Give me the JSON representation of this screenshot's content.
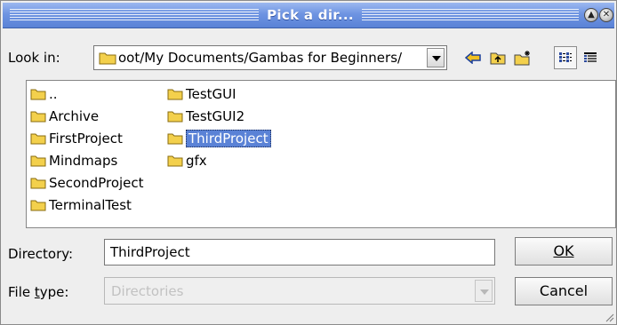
{
  "window": {
    "title": "Pick a dir..."
  },
  "lookin": {
    "label": "Look in:",
    "path": "oot/My Documents/Gambas for Beginners/"
  },
  "toolbar": [
    "back-arrow-icon",
    "parent-folder-icon",
    "new-folder-icon",
    "list-view-icon",
    "detail-view-icon"
  ],
  "files": [
    {
      "name": "..",
      "selected": false
    },
    {
      "name": "Archive",
      "selected": false
    },
    {
      "name": "FirstProject",
      "selected": false
    },
    {
      "name": "Mindmaps",
      "selected": false
    },
    {
      "name": "SecondProject",
      "selected": false
    },
    {
      "name": "TerminalTest",
      "selected": false
    },
    {
      "name": "TestGUI",
      "selected": false
    },
    {
      "name": "TestGUI2",
      "selected": false
    },
    {
      "name": "ThirdProject",
      "selected": true
    },
    {
      "name": "gfx",
      "selected": false
    }
  ],
  "directory": {
    "label": "Directory:",
    "value": "ThirdProject"
  },
  "filetype": {
    "label": "File type:",
    "value": "Directories"
  },
  "buttons": {
    "ok": "OK",
    "cancel": "Cancel"
  },
  "colors": {
    "titlebar": "#6e94e2",
    "selection": "#5a82d6",
    "folder": "#f3d04c",
    "background": "#eeeeee"
  }
}
